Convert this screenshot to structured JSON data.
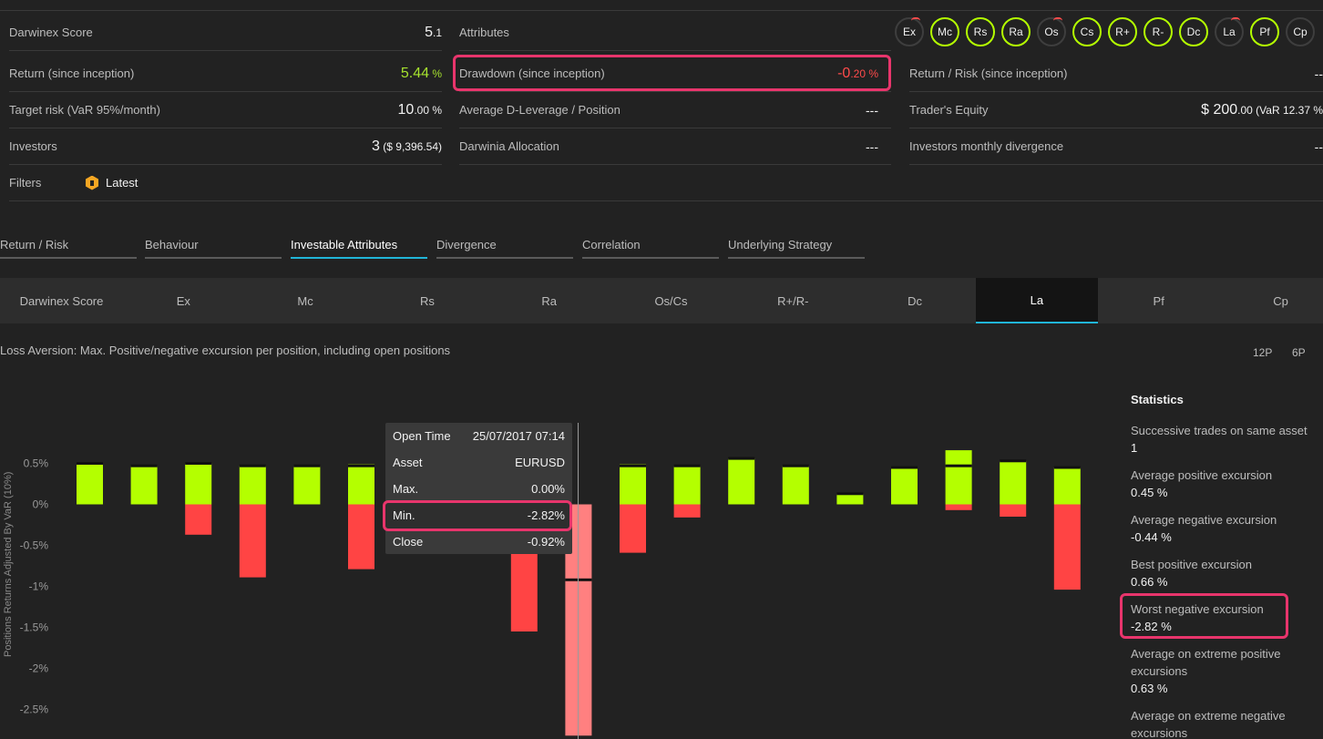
{
  "summary": {
    "col1": [
      {
        "label": "Darwinex Score",
        "value": "5",
        "dec": ".1",
        "extra": ""
      },
      {
        "label": "Return (since inception)",
        "value": "5.44",
        "dec": " %",
        "extra": ""
      },
      {
        "label": "Target risk (VaR 95%/month)",
        "value": "10",
        "dec": ".00 %",
        "extra": ""
      },
      {
        "label": "Investors",
        "value": "3",
        "dec": "",
        "extra": " ($ 9,396.54)"
      }
    ],
    "col2": [
      {
        "label": "Attributes",
        "value": ""
      },
      {
        "label": "Drawdown (since inception)",
        "value": "-0",
        "dec": ".20 %"
      },
      {
        "label": "Average D-Leverage / Position",
        "value": "---",
        "dec": ""
      },
      {
        "label": "Darwinia Allocation",
        "value": "---",
        "dec": ""
      }
    ],
    "col3": [
      {
        "label": "Return / Risk (since inception)",
        "value": "--"
      },
      {
        "label": "Trader's Equity",
        "value": "$ 200",
        "dec": ".00",
        "extra": " (VaR 12.37 %"
      },
      {
        "label": "Investors monthly divergence",
        "value": "--"
      }
    ],
    "filters_label": "Filters",
    "filter_value": "Latest",
    "filter_icon": "shield-icon"
  },
  "attributes": [
    "Ex",
    "Mc",
    "Rs",
    "Ra",
    "Os",
    "Cs",
    "R+",
    "R-",
    "Dc",
    "La",
    "Pf",
    "Cp"
  ],
  "colors": {
    "positive": "#b4ff00",
    "negative": "#ff4444",
    "negative_selected": "#ff8080",
    "accent": "#21b5d8",
    "highlight": "#e8356c"
  },
  "tabs": [
    "Return / Risk",
    "Behaviour",
    "Investable Attributes",
    "Divergence",
    "Correlation",
    "Underlying Strategy"
  ],
  "active_tab": "Investable Attributes",
  "subtabs": [
    "Darwinex Score",
    "Ex",
    "Mc",
    "Rs",
    "Ra",
    "Os/Cs",
    "R+/R-",
    "Dc",
    "La",
    "Pf",
    "Cp"
  ],
  "active_subtab": "La",
  "description": "Loss Aversion: Max. Positive/negative excursion per position, including open positions",
  "periods": [
    "12P",
    "6P"
  ],
  "tooltip": {
    "rows": [
      {
        "k": "Open Time",
        "v": "25/07/2017 07:14"
      },
      {
        "k": "Asset",
        "v": "EURUSD"
      },
      {
        "k": "Max.",
        "v": "0.00%"
      },
      {
        "k": "Min.",
        "v": "-2.82%"
      },
      {
        "k": "Close",
        "v": "-0.92%"
      }
    ]
  },
  "statistics": {
    "title": "Statistics",
    "items": [
      {
        "k": "Successive trades on same asset",
        "v": "1"
      },
      {
        "k": "Average positive excursion",
        "v": "0.45 %"
      },
      {
        "k": "Average negative excursion",
        "v": "-0.44 %"
      },
      {
        "k": "Best positive excursion",
        "v": "0.66 %"
      },
      {
        "k": "Worst negative excursion",
        "v": "-2.82 %"
      },
      {
        "k": "Average on extreme positive excursions",
        "v": "0.63 %"
      },
      {
        "k": "Average on extreme negative excursions",
        "v": ""
      }
    ]
  },
  "chart_data": {
    "type": "bar",
    "ylabel": "Positions Returns Adjusted By VaR (10%)",
    "ylim": [
      -2.85,
      0.7
    ],
    "yticks": [
      "0.5%",
      "0%",
      "-0.5%",
      "-1%",
      "-1.5%",
      "-2%",
      "-2.5%"
    ],
    "ytick_values": [
      0.5,
      0,
      -0.5,
      -1,
      -1.5,
      -2,
      -2.5
    ],
    "series": [
      {
        "name": "Max.",
        "values": [
          0.5,
          0.47,
          0.5,
          0.47,
          0.47,
          0.49,
          0.0,
          0.0,
          0.0,
          0.0,
          0.49,
          0.47,
          0.56,
          0.47,
          0.13,
          0.45,
          0.66,
          0.53,
          0.45
        ]
      },
      {
        "name": "Min.",
        "values": [
          0.0,
          0.0,
          -0.37,
          -0.89,
          0.0,
          -0.79,
          0.0,
          0.0,
          -1.55,
          -2.82,
          -0.59,
          -0.16,
          0.0,
          0.0,
          0.0,
          0.0,
          -0.07,
          -0.15,
          -1.04
        ]
      },
      {
        "name": "Close",
        "values": [
          0.5,
          0.47,
          0.5,
          0.47,
          0.47,
          0.47,
          0.0,
          0.0,
          0.0,
          -0.92,
          0.47,
          0.47,
          0.56,
          0.47,
          0.13,
          0.45,
          0.47,
          0.53,
          0.45
        ]
      }
    ],
    "selected_index": 9
  }
}
